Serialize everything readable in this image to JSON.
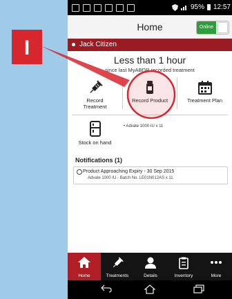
{
  "status_bar": {
    "battery": "95%",
    "time": "12:57",
    "icons": [
      "facebook-icon",
      "copy-icon",
      "image-icon",
      "mail-icon",
      "phone-icon",
      "briefcase-icon",
      "shield-icon",
      "signal-icon",
      "battery-icon"
    ]
  },
  "header": {
    "title": "Home",
    "toggle_label": "Online",
    "toggle_state": "on"
  },
  "user": {
    "name": "Jack Citizen"
  },
  "summary": {
    "headline": "Less than 1 hour",
    "subtitle": "since last MyABDR recorded treatment"
  },
  "tiles": [
    {
      "label_line1": "Record",
      "label_line2": "Treatment",
      "icon": "syringe-icon"
    },
    {
      "label": "Record Product",
      "icon": "vial-icon"
    },
    {
      "label": "Treatment Plan",
      "icon": "calendar-icon"
    },
    {
      "label": "Stock on hand",
      "icon": "fridge-icon"
    }
  ],
  "stock_note": "• Advate 1000 IU x 11",
  "notifications": {
    "heading": "Notifications (1)",
    "items": [
      {
        "title": "Product Approaching Expiry - 30 Sep 2015",
        "detail": "Advate 1000 IU - Batch No. LE01N012AS x 11",
        "icon": "clock-icon"
      }
    ]
  },
  "tabs": [
    {
      "label": "Home",
      "icon": "home-icon",
      "active": true
    },
    {
      "label": "Treatments",
      "icon": "syringe-icon"
    },
    {
      "label": "Details",
      "icon": "person-icon"
    },
    {
      "label": "Inventory",
      "icon": "clipboard-icon"
    },
    {
      "label": "More",
      "icon": "more-icon"
    }
  ],
  "nav_buttons": [
    "back-icon",
    "home-outline-icon",
    "recents-icon"
  ],
  "annotation": {
    "marker_label": "I",
    "marker_color": "#d7262e",
    "arrow_color": "#d7262e"
  },
  "colors": {
    "accent": "#9b1b22",
    "online_green": "#2e9e3a",
    "tab_active": "#b01f26",
    "background": "#9fcbe8"
  }
}
